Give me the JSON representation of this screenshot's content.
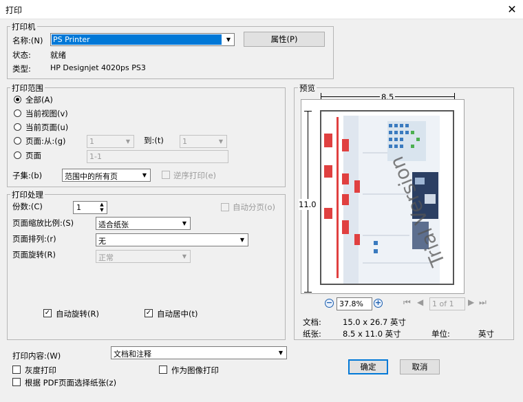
{
  "dialog": {
    "title": "打印",
    "close_icon": "close-icon"
  },
  "printer": {
    "group_label": "打印机",
    "name_label": "名称:(N)",
    "name_value": "PS Printer",
    "properties_button": "属性(P)",
    "status_label": "状态:",
    "status_value": "就绪",
    "type_label": "类型:",
    "type_value": "HP Designjet 4020ps PS3"
  },
  "range": {
    "group_label": "打印范围",
    "all": "全部(A)",
    "current_view": "当前视图(v)",
    "current_page": "当前页面(u)",
    "pages_from": "页面:从:(g)",
    "from_value": "1",
    "to_label": "到:(t)",
    "to_value": "1",
    "pages": "页面",
    "pages_value": "1-1",
    "subset_label": "子集:(b)",
    "subset_value": "范围中的所有页",
    "reverse": "逆序打印(e)"
  },
  "handling": {
    "group_label": "打印处理",
    "copies_label": "份数:(C)",
    "copies_value": "1",
    "collate": "自动分页(o)",
    "scaling_label": "页面缩放比例:(S)",
    "scaling_value": "适合纸张",
    "arrange_label": "页面排列:(r)",
    "arrange_value": "无",
    "rotate_label": "页面旋转(R)",
    "rotate_value": "正常",
    "auto_rotate": "自动旋转(R)",
    "auto_center": "自动居中(t)"
  },
  "content": {
    "label": "打印内容:(W)",
    "value": "文档和注释",
    "grayscale": "灰度打印",
    "as_image": "作为图像打印",
    "pdf_paper": "根据 PDF页面选择纸张(z)"
  },
  "preview": {
    "group_label": "预览",
    "width_dim": "8.5",
    "height_dim": "11.0",
    "zoom_value": "37.8%",
    "page_indicator": "1 of 1",
    "doc_label": "文档:",
    "doc_value": "15.0 x 26.7 英寸",
    "paper_label": "纸张:",
    "paper_value": "8.5 x 11.0 英寸",
    "unit_label": "单位:",
    "unit_value": "英寸",
    "watermark": "Trial Version"
  },
  "buttons": {
    "ok": "确定",
    "cancel": "取消"
  },
  "colors": {
    "accent": "#0078d7"
  }
}
